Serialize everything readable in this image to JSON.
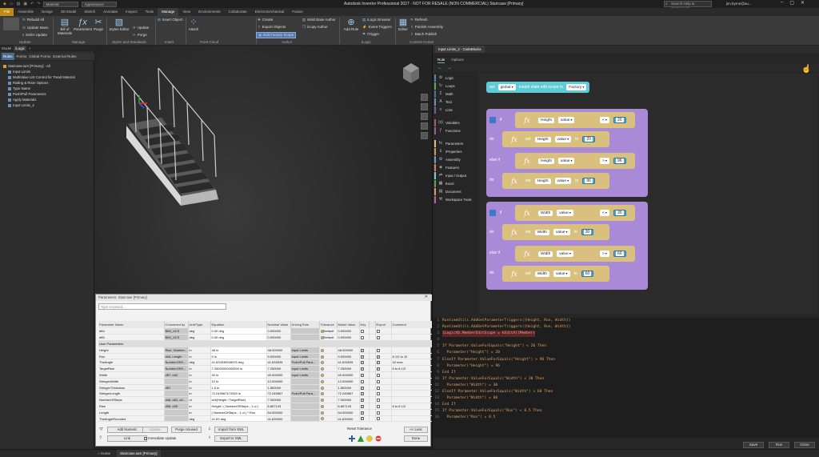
{
  "titlebar": {
    "file_tab": "File",
    "title": "Autodesk Inventor Professional 2027 - NOT FOR RESALE (NON COMMERCIAL)     Staircase [Primary]",
    "quick_select_1": "Material",
    "quick_select_2": "Appearance",
    "search_placeholder": "Search Help & Commands...",
    "user": "jim.byrne@au...",
    "minimize": "–",
    "maximize": "▢",
    "close": "✕"
  },
  "ribbon_tabs": [
    "Assemble",
    "Design",
    "3D Model",
    "Sketch",
    "Annotate",
    "Inspect",
    "Tools",
    "Manage",
    "View",
    "Environments",
    "Collaborate",
    "Electromechanical",
    "Fusion"
  ],
  "ribbon": {
    "update": {
      "rebuild_all": "Rebuild All",
      "update_mass": "Update Mass",
      "defer_update": "Defer Update",
      "group": "Update"
    },
    "manage": {
      "bill_of_materials": "Bill of Materials",
      "parameters": "Parameters",
      "purge": "Purge",
      "group": "Manage"
    },
    "styles": {
      "styles_editor": "Styles Editor",
      "update": "Update",
      "purge": "Purge",
      "group": "Styles and Standards"
    },
    "insert": {
      "insert_object": "Insert Object",
      "group": "Insert"
    },
    "point_cloud": {
      "attach": "Attach",
      "group": "Point Cloud"
    },
    "author": {
      "create": "Create",
      "export_objects": "Export Objects",
      "edit_factory_scope": "Edit Factory Scope",
      "mold_base_author": "Mold Base Author",
      "icopy_author": "iCopy Author",
      "group": "Author"
    },
    "ilogic": {
      "add_rule": "Add Rule",
      "logic_browser": "iLogic Browser",
      "event_triggers": "Event Triggers",
      "itrigger": "iTrigger",
      "group": "iLogic"
    },
    "content_center": {
      "editor": "Editor",
      "refresh": "Refresh",
      "publish_assembly": "Publish Assembly",
      "batch_publish": "Batch Publish",
      "group": "Content Center"
    }
  },
  "left_panel": {
    "tabs": [
      "Model",
      "iLogic",
      "+"
    ],
    "subtabs": [
      "Rules",
      "Forms",
      "Global Forms",
      "External Rules"
    ],
    "tree": [
      {
        "label": "Staircase.iam [Primary] - All",
        "root": true
      },
      {
        "label": "Input Limits"
      },
      {
        "label": "MultiValue List Control for Tread Material"
      },
      {
        "label": "Railing & Riser Options"
      },
      {
        "label": "Type Name"
      },
      {
        "label": "Push/Pull Parameters"
      },
      {
        "label": "Apply Materials"
      },
      {
        "label": "Input Limits_2"
      }
    ]
  },
  "params_dialog": {
    "title": "Parameters: Staircase [Primary]",
    "close": "✕",
    "search_placeholder": "Type Keyword...",
    "headers": [
      "Parameter Name",
      "Consumed by",
      "Unit/Type",
      "Equation",
      "Nominal Value",
      "Driving Rule",
      "Tolerance",
      "Model Value",
      "Key",
      "",
      "Export",
      "Comment"
    ],
    "rows": [
      {
        "name": "d84",
        "consumed": "BIM_UCS",
        "unit": "deg",
        "eq": "0.00 deg",
        "nominal": "0.000000",
        "rule": "",
        "tol": "Default",
        "model": "0.000000",
        "key": false,
        "export": false,
        "comment": "",
        "group": false
      },
      {
        "name": "d85",
        "consumed": "BIM_UCS",
        "unit": "deg",
        "eq": "0.00 deg",
        "nominal": "0.000000",
        "rule": "",
        "tol": "Default",
        "model": "0.000000",
        "key": false,
        "export": false,
        "comment": "",
        "group": false
      },
      {
        "name": "User Parameters",
        "group": true
      },
      {
        "name": "Height",
        "consumed": "Rise, Number...",
        "unit": "in",
        "eq": "48 in",
        "nominal": "48.000000",
        "rule": "Input Limits",
        "tol": "",
        "model": "48.000000",
        "key": true,
        "export": false,
        "comment": "",
        "group": false
      },
      {
        "name": "Run",
        "consumed": "d44, Length",
        "unit": "in",
        "eq": "9 in",
        "nominal": "9.000000",
        "rule": "Input Limits",
        "tol": "",
        "model": "9.000000",
        "key": true,
        "export": true,
        "comment": "8 1/2 to 12",
        "group": false
      },
      {
        "name": "TheAngle",
        "consumed": "NumberOfSt...",
        "unit": "deg",
        "eq": "41.633539536576 deg",
        "nominal": "41.633539",
        "rule": "Push/Pull Para...",
        "tol": "",
        "model": "41.633539",
        "key": true,
        "export": true,
        "comment": "42 max",
        "group": false
      },
      {
        "name": "TargetRise",
        "consumed": "NumberOfSt...",
        "unit": "in",
        "eq": "7.25000000000000 in",
        "nominal": "7.250000",
        "rule": "Input Limits",
        "tol": "",
        "model": "7.250000",
        "key": true,
        "export": true,
        "comment": "6 to 8 1/2",
        "group": false
      },
      {
        "name": "Width",
        "consumed": "d57, d42",
        "unit": "in",
        "eq": "40 in",
        "nominal": "40.000000",
        "rule": "Input Limits",
        "tol": "",
        "model": "40.000000",
        "key": true,
        "export": false,
        "comment": "",
        "group": false
      },
      {
        "name": "StringerWidth",
        "consumed": "",
        "unit": "in",
        "eq": "12 in",
        "nominal": "12.000000",
        "rule": "",
        "tol": "",
        "model": "12.000000",
        "key": false,
        "export": false,
        "comment": "",
        "group": false
      },
      {
        "name": "StringerThickness",
        "consumed": "d57",
        "unit": "in",
        "eq": "1.5 in",
        "nominal": "1.500000",
        "rule": "",
        "tol": "",
        "model": "1.500000",
        "key": true,
        "export": false,
        "comment": "",
        "group": false
      },
      {
        "name": "StringerLength",
        "consumed": "",
        "unit": "in",
        "eq": "72.249567472539 in",
        "nominal": "72.249567",
        "rule": "Push/Pull Para...",
        "tol": "",
        "model": "72.249567",
        "key": true,
        "export": false,
        "comment": "",
        "group": false
      },
      {
        "name": "NumberOfSteps",
        "consumed": "d46, d62, d4...",
        "unit": "ul",
        "eq": "ceil(Height / TargetRise)",
        "nominal": "7.000000",
        "rule": "",
        "tol": "",
        "model": "7.000000",
        "key": true,
        "export": false,
        "comment": "",
        "group": false
      },
      {
        "name": "Rise",
        "consumed": "d56, d35",
        "unit": "in",
        "eq": "Height / ( NumberOfSteps - 1 ul )",
        "nominal": "6.857143",
        "rule": "",
        "tol": "",
        "model": "6.857143",
        "key": true,
        "export": false,
        "comment": "6 to 8 1/2",
        "group": false
      },
      {
        "name": "Length",
        "consumed": "",
        "unit": "in",
        "eq": "( NumberOfSteps - 1 ul ) * Run",
        "nominal": "54.000000",
        "rule": "",
        "tol": "",
        "model": "54.000000",
        "key": true,
        "export": false,
        "comment": "",
        "group": false
      },
      {
        "name": "TheAngleRounded",
        "consumed": "",
        "unit": "deg",
        "eq": "41.63 deg",
        "nominal": "41.630000",
        "rule": "",
        "tol": "",
        "model": "41.630000",
        "key": true,
        "export": false,
        "comment": "",
        "group": false
      }
    ],
    "add_numeric": "Add Numeric",
    "update": "Update",
    "purge_unused": "Purge Unused",
    "import_from_xml": "Import from XML",
    "export_to_xml": "Export to XML",
    "link": "Link",
    "immediate_update": "Immediate Update",
    "reset_tolerance": "Reset Tolerance",
    "less": "<< Less",
    "done": "Done"
  },
  "status_tabs": [
    "Home",
    "Staircase.iam [Primary]"
  ],
  "editor": {
    "tab": "Input Limits_2 - CodeBlocks",
    "subtabs": [
      "Rule",
      "Options"
    ],
    "categories": [
      {
        "icon": "⚙",
        "label": "Logic",
        "color": "#5b80a5"
      },
      {
        "icon": "↻",
        "label": "Loops",
        "color": "#5ba55b"
      },
      {
        "icon": "Σ",
        "label": "Math",
        "color": "#5b67a5"
      },
      {
        "icon": "A",
        "label": "Text",
        "color": "#5ba58c"
      },
      {
        "icon": "≡",
        "label": "Lists",
        "color": "#745ba5"
      },
      {
        "icon": "(x)",
        "label": "Variables",
        "color": "#a55b80"
      },
      {
        "icon": "ƒ",
        "label": "Functions",
        "color": "#995ba5"
      },
      {
        "icon": "fx",
        "label": "Parameters",
        "color": "#d9c07e"
      },
      {
        "icon": "ℹ",
        "label": "iProperties",
        "color": "#c9a24a"
      },
      {
        "icon": "⚙",
        "label": "Assembly",
        "color": "#6b9fd9"
      },
      {
        "icon": "◈",
        "label": "Features",
        "color": "#d97e7e"
      },
      {
        "icon": "⇄",
        "label": "Input / Output",
        "color": "#7ec9d9"
      },
      {
        "icon": "▦",
        "label": "Excel",
        "color": "#5ba55b"
      },
      {
        "icon": "▤",
        "label": "Document",
        "color": "#d9a05b"
      },
      {
        "icon": "⚒",
        "label": "Workspace Tools",
        "color": "#c95ba5"
      }
    ],
    "blocks": {
      "set_label": "set",
      "scope_value": "global",
      "scope_text": "model state edit scope to",
      "scope_target": "Factory",
      "if_label": "if",
      "do_label": "do",
      "else_if_label": "else if",
      "value_label": "value",
      "to_label": "to",
      "fx_label": "fx",
      "if1": {
        "cond1": {
          "param": "Height",
          "op": "<",
          "num": "20"
        },
        "do1": {
          "param": "Height",
          "num": "20"
        },
        "cond2": {
          "param": "Height",
          "op": ">",
          "num": "96"
        },
        "do2": {
          "param": "Height",
          "num": "96"
        }
      },
      "if2": {
        "cond1": {
          "param": "Width",
          "op": "<",
          "num": "30"
        },
        "do1": {
          "param": "Width",
          "num": "30"
        },
        "cond2": {
          "param": "Width",
          "op": ">",
          "num": "60"
        },
        "do2": {
          "param": "Width",
          "num": "60"
        }
      }
    },
    "code_lines": [
      {
        "n": "1",
        "t": "RuntimeUtils.AddGetParameterTriggers({Height, Run, Width})",
        "hl": false
      },
      {
        "n": "2",
        "t": "RuntimeUtils.AddSetParameterTriggers({Height, Run, Width})",
        "hl": false
      },
      {
        "n": "3",
        "t": "iLogicVb.MemberEditScope = kEditAllMembers",
        "hl": true
      },
      {
        "n": "4",
        "t": "",
        "hl": false
      },
      {
        "n": "5",
        "t": "If Parameter.ValueForEquals(\"Height\") < 20 Then",
        "hl": false
      },
      {
        "n": "6",
        "t": "  Parameter(\"Height\") = 20",
        "hl": false
      },
      {
        "n": "7",
        "t": "ElseIf Parameter.ValueForEquals(\"Height\") > 96 Then",
        "hl": false
      },
      {
        "n": "8",
        "t": "  Parameter(\"Height\") = 96",
        "hl": false
      },
      {
        "n": "9",
        "t": "End If",
        "hl": false
      },
      {
        "n": "10",
        "t": "If Parameter.ValueForEquals(\"Width\") < 30 Then",
        "hl": false
      },
      {
        "n": "11",
        "t": "  Parameter(\"Width\") = 30",
        "hl": false
      },
      {
        "n": "12",
        "t": "ElseIf Parameter.ValueForEquals(\"Width\") > 60 Then",
        "hl": false
      },
      {
        "n": "13",
        "t": "  Parameter(\"Width\") = 60",
        "hl": false
      },
      {
        "n": "14",
        "t": "End If",
        "hl": false
      },
      {
        "n": "15",
        "t": "If Parameter.ValueForEquals(\"Run\") < 8.5 Then",
        "hl": false
      },
      {
        "n": "16",
        "t": "  Parameter(\"Run\") = 8.5",
        "hl": false
      }
    ],
    "save": "Save",
    "run": "Run",
    "close": "Close"
  },
  "colors": {
    "accent": "#5577aa",
    "param_block": "#d9c07e",
    "logic_block": "#a98ad6",
    "number_block": "#4fa3d1",
    "code_text": "#e7a05b",
    "file_tab": "#c08a1a"
  }
}
